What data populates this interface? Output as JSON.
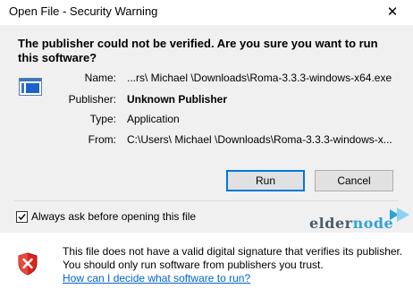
{
  "window": {
    "title": "Open File - Security Warning",
    "close_glyph": "✕"
  },
  "question": "The publisher could not be verified.  Are you sure you want to run this software?",
  "details": [
    {
      "label": "Name:",
      "value": "...rs\\ Michael \\Downloads\\Roma-3.3.3-windows-x64.exe",
      "bold": false
    },
    {
      "label": "Publisher:",
      "value": "Unknown Publisher",
      "bold": true
    },
    {
      "label": "Type:",
      "value": "Application",
      "bold": false
    },
    {
      "label": "From:",
      "value": "C:\\Users\\ Michael \\Downloads\\Roma-3.3.3-windows-x...",
      "bold": false
    }
  ],
  "buttons": {
    "run": "Run",
    "cancel": "Cancel"
  },
  "checkbox": {
    "label": "Always ask before opening this file",
    "checked": true
  },
  "watermark": {
    "part1": "elder",
    "part2": "node"
  },
  "warning": {
    "text": "This file does not have a valid digital signature that verifies its publisher.  You should only run software from publishers you trust.",
    "link": "How can I decide what software to run?"
  },
  "colors": {
    "accent": "#0078d7",
    "link": "#0066cc",
    "shield_red": "#d9261c",
    "panel_bg": "#f0f0f0"
  },
  "icons": {
    "app": "application-window-icon",
    "shield": "shield-error-icon",
    "close": "close-icon",
    "checkmark": "checkmark-icon"
  }
}
